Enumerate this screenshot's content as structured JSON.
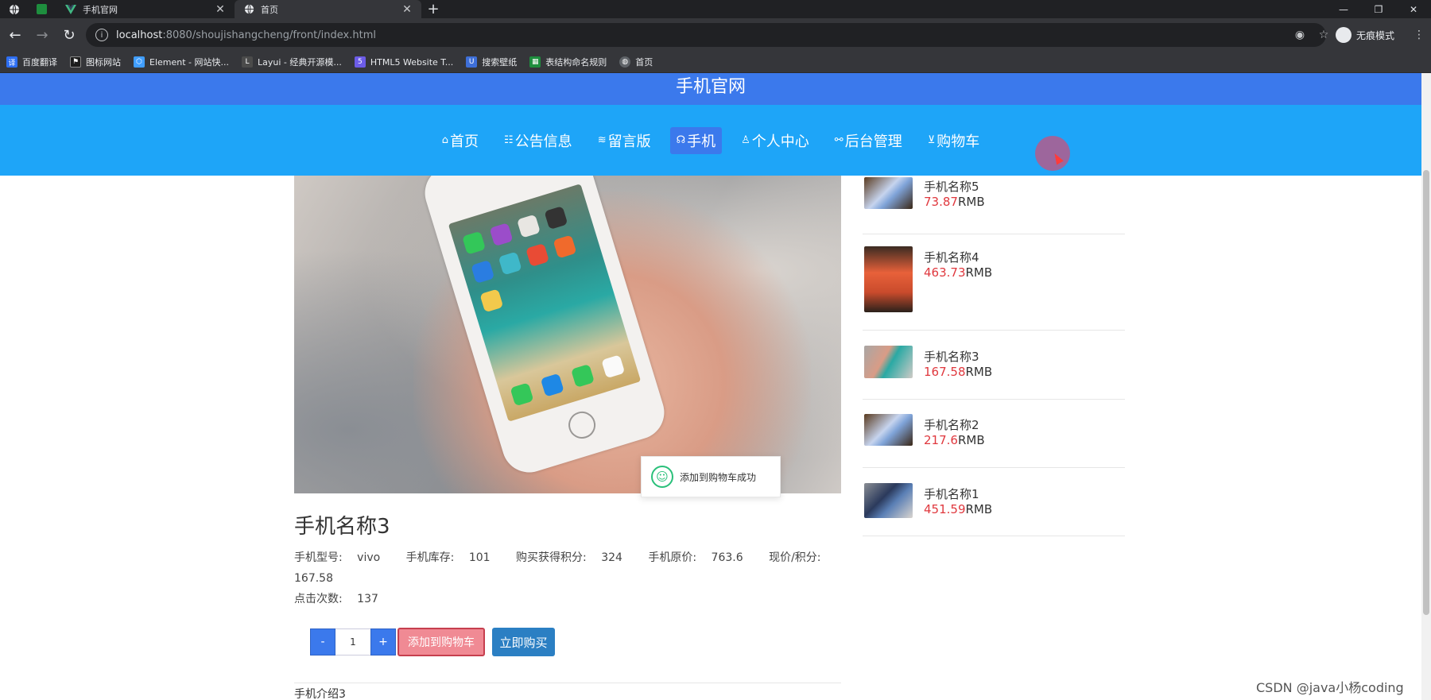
{
  "browser": {
    "tabs": [
      {
        "title": "手机官网",
        "active": false
      },
      {
        "title": "首页",
        "active": true
      }
    ],
    "url_host": "localhost",
    "url_path": ":8080/shoujishangcheng/front/index.html",
    "profile_label": "无痕模式",
    "bookmarks": [
      {
        "label": "百度翻译",
        "color": "#2d6ef2"
      },
      {
        "label": "图标网站",
        "color": "#1c1c1c"
      },
      {
        "label": "Element - 网站快...",
        "color": "#409eff"
      },
      {
        "label": "Layui - 经典开源模...",
        "color": "#4b4b4b"
      },
      {
        "label": "HTML5 Website T...",
        "color": "#6c5ce7"
      },
      {
        "label": "搜索壁纸",
        "color": "#3e6fd8"
      },
      {
        "label": "表结构命名规则",
        "color": "#1e8e3e"
      },
      {
        "label": "首页",
        "color": "#5f6368"
      }
    ]
  },
  "site": {
    "title": "手机官网",
    "nav": [
      {
        "label": "首页",
        "icon": "home-icon",
        "glyph": "⌂",
        "active": false
      },
      {
        "label": "公告信息",
        "icon": "notice-icon",
        "glyph": "☷",
        "active": false
      },
      {
        "label": "留言版",
        "icon": "message-icon",
        "glyph": "≋",
        "active": false
      },
      {
        "label": "手机",
        "icon": "phone-icon",
        "glyph": "☊",
        "active": true
      },
      {
        "label": "个人中心",
        "icon": "user-icon",
        "glyph": "♙",
        "active": false
      },
      {
        "label": "后台管理",
        "icon": "link-icon",
        "glyph": "⚯",
        "active": false
      },
      {
        "label": "购物车",
        "icon": "cart-icon",
        "glyph": "⊻",
        "active": false
      }
    ]
  },
  "product": {
    "name": "手机名称3",
    "model_label": "手机型号:",
    "model": "vivo",
    "stock_label": "手机库存:",
    "stock": "101",
    "points_label": "购买获得积分:",
    "points": "324",
    "original_price_label": "手机原价:",
    "original_price": "763.6",
    "current_price_label": "现价/积分:",
    "current_price": "167.58",
    "clicks_label": "点击次数:",
    "clicks": "137",
    "quantity": "1",
    "minus_label": "-",
    "plus_label": "+",
    "add_to_cart_label": "添加到购物车",
    "buy_now_label": "立即购买",
    "intro": "手机介绍3"
  },
  "toast": {
    "message": "添加到购物车成功"
  },
  "sidebar": {
    "items": [
      {
        "name": "手机名称5",
        "price": "73.87",
        "unit": "RMB"
      },
      {
        "name": "手机名称4",
        "price": "463.73",
        "unit": "RMB"
      },
      {
        "name": "手机名称3",
        "price": "167.58",
        "unit": "RMB"
      },
      {
        "name": "手机名称2",
        "price": "217.6",
        "unit": "RMB"
      },
      {
        "name": "手机名称1",
        "price": "451.59",
        "unit": "RMB"
      }
    ]
  },
  "watermark": "CSDN @java小杨coding"
}
